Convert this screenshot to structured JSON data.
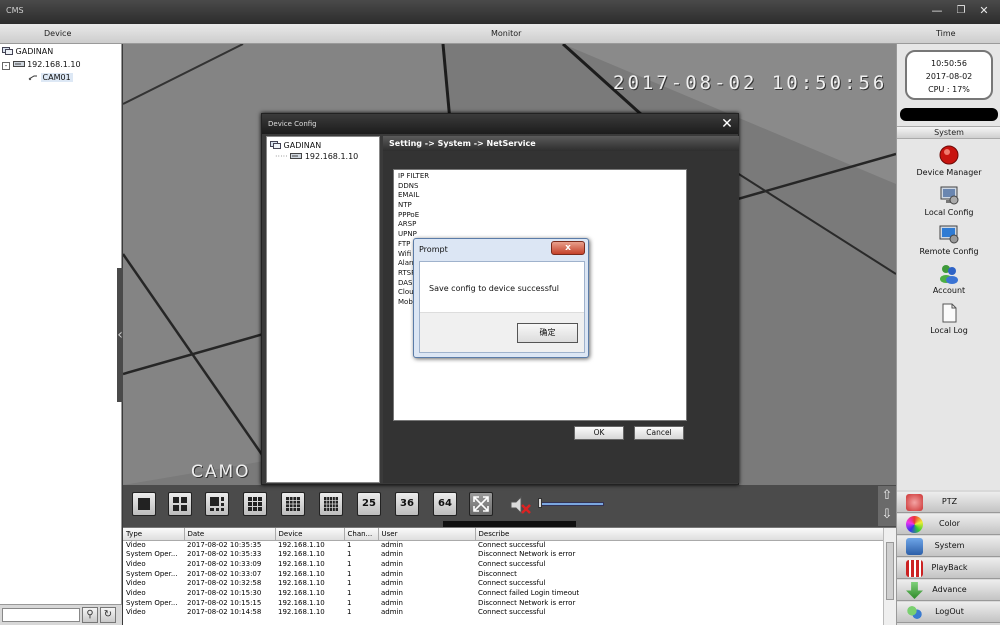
{
  "app": {
    "title": "CMS"
  },
  "header": {
    "device_label": "Device",
    "monitor_label": "Monitor",
    "time_label": "Time"
  },
  "device_tree": {
    "root": "GADINAN",
    "device": "192.168.1.10",
    "camera": "CAM01"
  },
  "video": {
    "osd_time": "2017-08-02 10:50:56",
    "osd_cam": "CAMO"
  },
  "clock": {
    "time": "10:50:56",
    "date": "2017-08-02",
    "cpu": "CPU : 17%"
  },
  "system_panel": {
    "header": "System",
    "items": [
      {
        "label": "Device Manager",
        "icon": "device-manager-icon"
      },
      {
        "label": "Local Config",
        "icon": "local-config-icon"
      },
      {
        "label": "Remote Config",
        "icon": "remote-config-icon"
      },
      {
        "label": "Account",
        "icon": "account-icon"
      },
      {
        "label": "Local Log",
        "icon": "local-log-icon"
      }
    ]
  },
  "nav_buttons": [
    {
      "label": "PTZ",
      "icon": "ptz-icon"
    },
    {
      "label": "Color",
      "icon": "color-icon"
    },
    {
      "label": "System",
      "icon": "system-icon"
    },
    {
      "label": "PlayBack",
      "icon": "playback-icon"
    },
    {
      "label": "Advance",
      "icon": "advance-icon"
    },
    {
      "label": "LogOut",
      "icon": "logout-icon"
    }
  ],
  "toolbar": {
    "layouts": [
      "1",
      "4",
      "6",
      "9",
      "16",
      "20",
      "25",
      "36",
      "64"
    ],
    "num_labels": {
      "25": "25",
      "36": "36",
      "64": "64"
    }
  },
  "log_table": {
    "columns": [
      "Type",
      "Date",
      "Device",
      "Chan...",
      "User",
      "Describe"
    ],
    "rows": [
      [
        "Video",
        "2017-08-02 10:35:35",
        "192.168.1.10",
        "1",
        "admin",
        "Connect successful"
      ],
      [
        "System Oper...",
        "2017-08-02 10:35:33",
        "192.168.1.10",
        "1",
        "admin",
        "Disconnect Network is error"
      ],
      [
        "Video",
        "2017-08-02 10:33:09",
        "192.168.1.10",
        "1",
        "admin",
        "Connect successful"
      ],
      [
        "System Oper...",
        "2017-08-02 10:33:07",
        "192.168.1.10",
        "1",
        "admin",
        "Disconnect"
      ],
      [
        "Video",
        "2017-08-02 10:32:58",
        "192.168.1.10",
        "1",
        "admin",
        "Connect successful"
      ],
      [
        "Video",
        "2017-08-02 10:15:30",
        "192.168.1.10",
        "1",
        "admin",
        "Connect failed Login timeout"
      ],
      [
        "System Oper...",
        "2017-08-02 10:15:15",
        "192.168.1.10",
        "1",
        "admin",
        "Disconnect Network is error"
      ],
      [
        "Video",
        "2017-08-02 10:14:58",
        "192.168.1.10",
        "1",
        "admin",
        "Connect successful"
      ]
    ]
  },
  "device_config": {
    "title": "Device Config",
    "tree_root": "GADINAN",
    "tree_device": "192.168.1.10",
    "breadcrumb": "Setting -> System -> NetService",
    "services": [
      "IP FILTER",
      "DDNS",
      "EMAIL",
      "NTP",
      "PPPoE",
      "ARSP",
      "UPNP",
      "FTP",
      "Wifi",
      "Alarm",
      "RTSP",
      "DAS",
      "Cloud",
      "Mobile"
    ],
    "ok_label": "OK",
    "cancel_label": "Cancel"
  },
  "prompt": {
    "title": "Prompt",
    "close_label": "x",
    "message": "Save config to device successful",
    "ok_label": "确定"
  }
}
